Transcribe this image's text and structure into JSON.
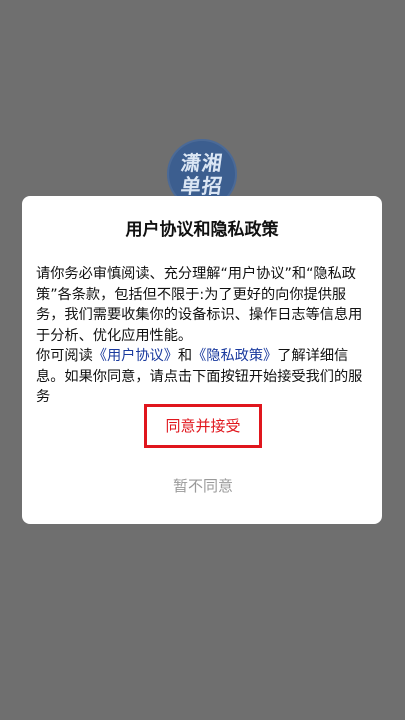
{
  "app": {
    "logo_line1": "潇湘",
    "logo_line2": "单招"
  },
  "dialog": {
    "title": "用户协议和隐私政策",
    "paragraph1": "请你务必审慎阅读、充分理解“用户协议”和“隐私政策”各条款，包括但不限于:为了更好的向你提供服务，我们需要收集你的设备标识、操作日志等信息用于分析、优化应用性能。",
    "paragraph2_prefix": "你可阅读",
    "user_agreement_link": "《用户协议》",
    "paragraph2_and": "和",
    "privacy_policy_link": "《隐私政策》",
    "paragraph2_suffix": "了解详细信息。如果你同意，请点击下面按钮开始接受我们的服务",
    "agree_label": "同意并接受",
    "disagree_label": "暂不同意"
  },
  "colors": {
    "backdrop": "#6f6f6f",
    "link": "#1a3a9e",
    "accent_red": "#e0161d",
    "muted_text": "#9a9a9a"
  }
}
